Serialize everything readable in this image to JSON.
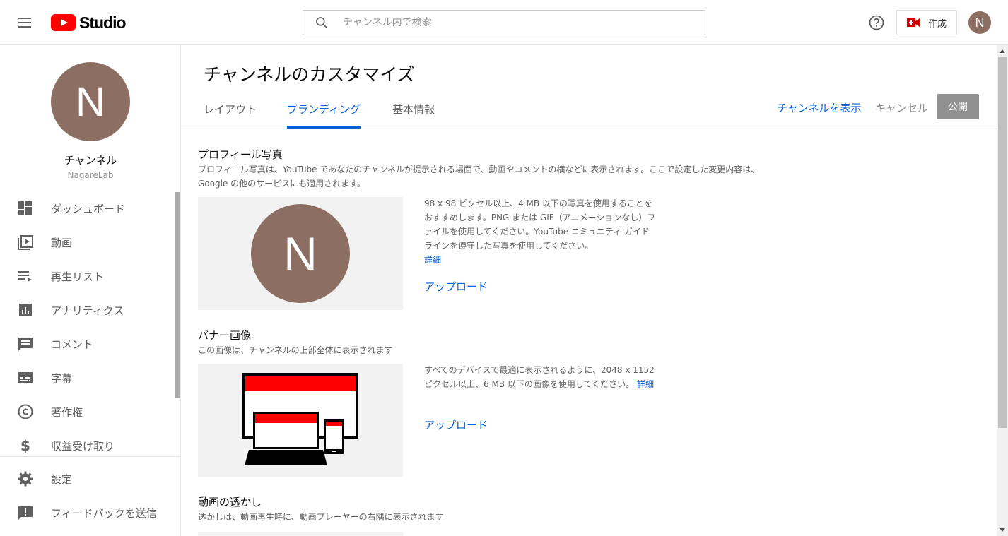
{
  "header": {
    "logo_text": "Studio",
    "search_placeholder": "チャンネル内で検索",
    "create_label": "作成",
    "avatar_initial": "N"
  },
  "sidebar": {
    "avatar_initial": "N",
    "channel_title": "チャンネル",
    "channel_handle": "NagareLab",
    "items": [
      {
        "label": "ダッシュボード",
        "icon": "dashboard-icon"
      },
      {
        "label": "動画",
        "icon": "video-icon"
      },
      {
        "label": "再生リスト",
        "icon": "playlist-icon"
      },
      {
        "label": "アナリティクス",
        "icon": "analytics-icon"
      },
      {
        "label": "コメント",
        "icon": "comment-icon"
      },
      {
        "label": "字幕",
        "icon": "subtitles-icon"
      },
      {
        "label": "著作権",
        "icon": "copyright-icon"
      },
      {
        "label": "収益受け取り",
        "icon": "dollar-icon"
      }
    ],
    "bottom_items": [
      {
        "label": "設定",
        "icon": "gear-icon"
      },
      {
        "label": "フィードバックを送信",
        "icon": "feedback-icon"
      }
    ]
  },
  "main": {
    "title": "チャンネルのカスタマイズ",
    "tabs": [
      {
        "label": "レイアウト",
        "active": false
      },
      {
        "label": "ブランディング",
        "active": true
      },
      {
        "label": "基本情報",
        "active": false
      }
    ],
    "actions": {
      "view_channel": "チャンネルを表示",
      "cancel": "キャンセル",
      "publish": "公開"
    },
    "sections": {
      "profile": {
        "title": "プロフィール写真",
        "desc_line1": "プロフィール写真は、YouTube であなたのチャンネルが提示される場面で、動画やコメントの横などに表示されます。ここで設定した変更内容は、",
        "desc_line2": "Google の他のサービスにも適用されます。",
        "avatar_initial": "N",
        "info": "98 x 98 ピクセル以上、4 MB 以下の写真を使用することをおすすめします。PNG または GIF（アニメーションなし）ファイルを使用してください。YouTube コミュニティ ガイドラインを遵守した写真を使用してください。",
        "more": "詳細",
        "upload": "アップロード"
      },
      "banner": {
        "title": "バナー画像",
        "desc": "この画像は、チャンネルの上部全体に表示されます",
        "info": "すべてのデバイスで最適に表示されるように、2048 x 1152 ピクセル以上、6 MB 以下の画像を使用してください。",
        "more": "詳細",
        "upload": "アップロード"
      },
      "watermark": {
        "title": "動画の透かし",
        "desc": "透かしは、動画再生時に、動画プレーヤーの右隅に表示されます"
      }
    }
  },
  "colors": {
    "accent": "#065fd4",
    "avatar": "#8d6e63",
    "brand_red": "#ff0000",
    "publish_disabled": "#909090"
  }
}
